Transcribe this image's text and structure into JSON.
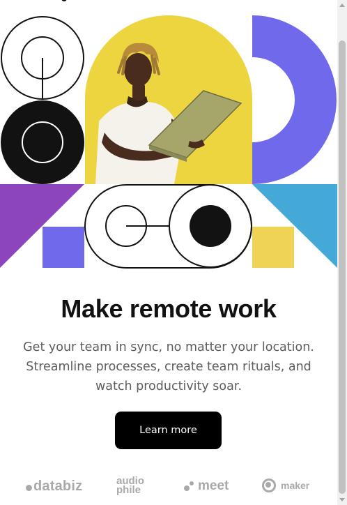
{
  "hero": {
    "image_alt": "Person holding a laptop on a yellow background",
    "colors": {
      "outline": "#121212",
      "yellow": "#ecd53f",
      "purple_violet": "#7069ec",
      "purple_magenta": "#8d45be",
      "sky_blue": "#45a9d8",
      "yellow_square": "#efd354"
    }
  },
  "headline": "Make remote work",
  "description": "Get your team in sync, no matter your location. Streamline processes, create team rituals, and watch productivity soar.",
  "cta": {
    "label": "Learn more"
  },
  "logos": [
    {
      "name": "databiz",
      "text": "databiz"
    },
    {
      "name": "audiophile",
      "line1": "audio",
      "line2": "phile"
    },
    {
      "name": "meet",
      "text": "meet"
    },
    {
      "name": "maker",
      "text": "maker"
    }
  ],
  "logo_color": "#a9a9a9",
  "accent_button_color": "#000000"
}
